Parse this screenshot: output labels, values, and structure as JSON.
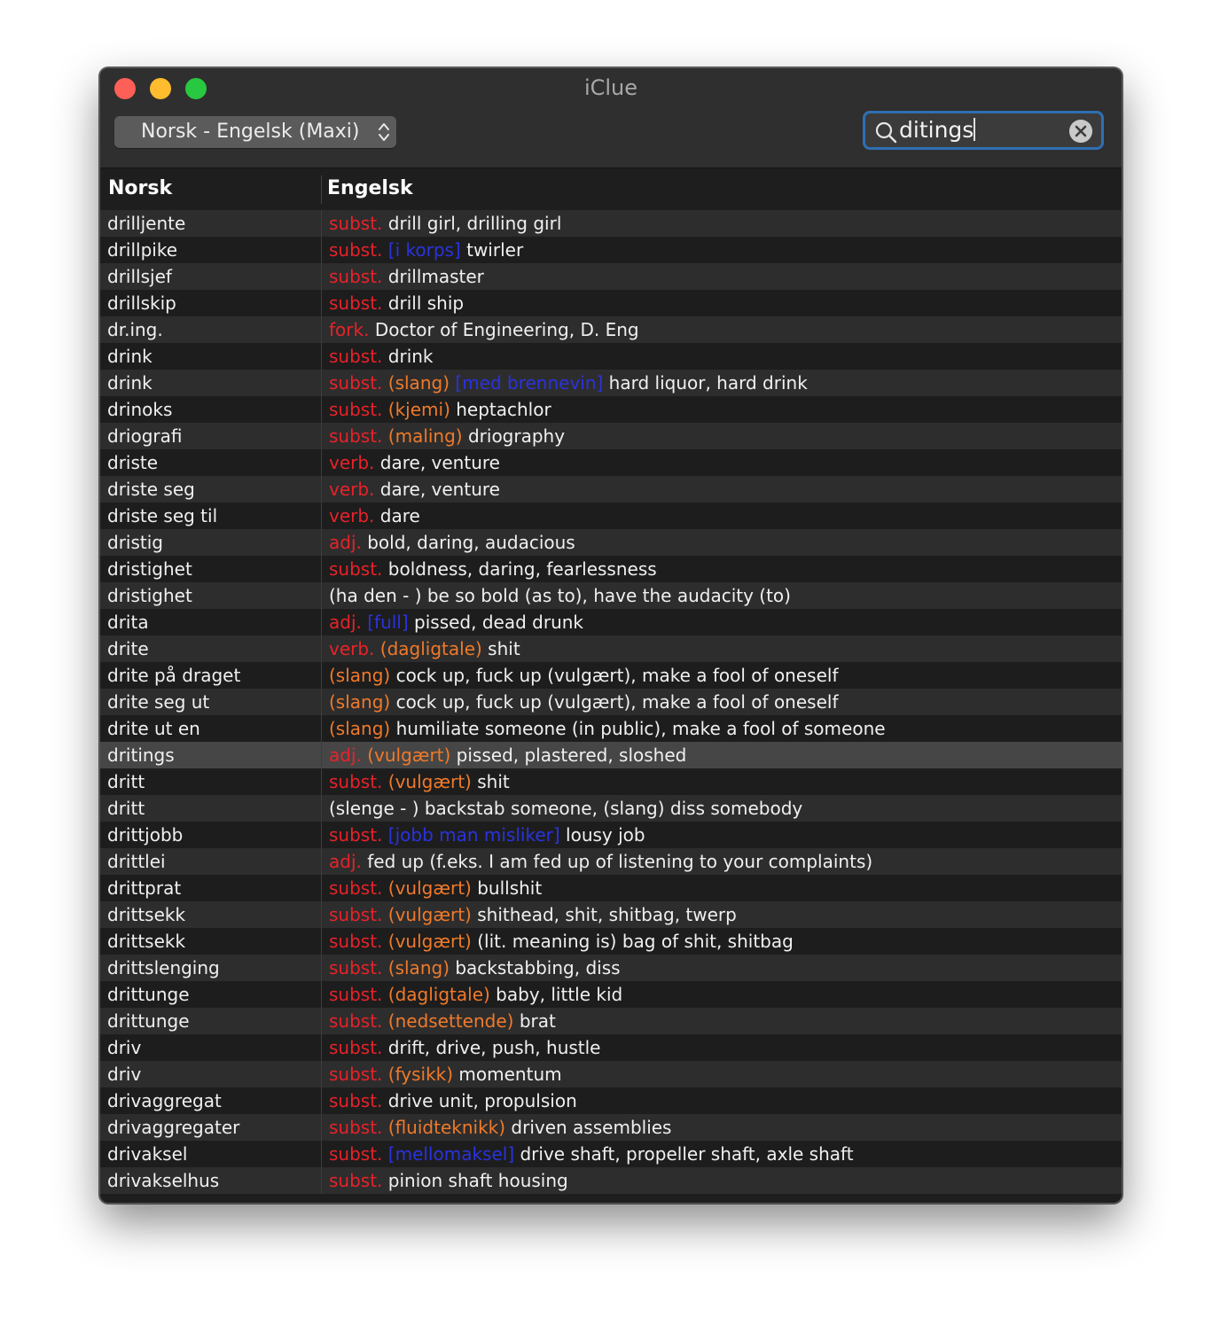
{
  "window": {
    "title": "iClue"
  },
  "dictionary_selector": {
    "value": "Norsk - Engelsk (Maxi)"
  },
  "search": {
    "value": "ditings"
  },
  "columns": {
    "left": "Norsk",
    "right": "Engelsk"
  },
  "selected_index": 20,
  "rows": [
    {
      "word": "drilljente",
      "pos": "subst.",
      "note": "",
      "ctx": "",
      "text": "drill girl, drilling girl"
    },
    {
      "word": "drillpike",
      "pos": "subst.",
      "note": "",
      "ctx": "[i korps]",
      "text": "twirler"
    },
    {
      "word": "drillsjef",
      "pos": "subst.",
      "note": "",
      "ctx": "",
      "text": "drillmaster"
    },
    {
      "word": "drillskip",
      "pos": "subst.",
      "note": "",
      "ctx": "",
      "text": "drill ship"
    },
    {
      "word": "dr.ing.",
      "pos": "fork.",
      "note": "",
      "ctx": "",
      "text": "Doctor of Engineering, D. Eng"
    },
    {
      "word": "drink",
      "pos": "subst.",
      "note": "",
      "ctx": "",
      "text": "drink"
    },
    {
      "word": "drink",
      "pos": "subst.",
      "note": "(slang)",
      "ctx": "[med brennevin]",
      "text": "hard liquor, hard drink"
    },
    {
      "word": "drinoks",
      "pos": "subst.",
      "note": "(kjemi)",
      "ctx": "",
      "text": "heptachlor"
    },
    {
      "word": "driografi",
      "pos": "subst.",
      "note": "(maling)",
      "ctx": "",
      "text": "driography"
    },
    {
      "word": "driste",
      "pos": "verb.",
      "note": "",
      "ctx": "",
      "text": "dare, venture"
    },
    {
      "word": "driste seg",
      "pos": "verb.",
      "note": "",
      "ctx": "",
      "text": "dare, venture"
    },
    {
      "word": "driste seg til",
      "pos": "verb.",
      "note": "",
      "ctx": "",
      "text": "dare"
    },
    {
      "word": "dristig",
      "pos": "adj.",
      "note": "",
      "ctx": "",
      "text": "bold, daring, audacious"
    },
    {
      "word": "dristighet",
      "pos": "subst.",
      "note": "",
      "ctx": "",
      "text": "boldness, daring, fearlessness"
    },
    {
      "word": "dristighet",
      "pos": "",
      "note": "",
      "ctx": "",
      "text": "(ha den - ) be so bold (as to), have the audacity (to)"
    },
    {
      "word": "drita",
      "pos": "adj.",
      "note": "",
      "ctx": "[full]",
      "text": "pissed, dead drunk"
    },
    {
      "word": "drite",
      "pos": "verb.",
      "note": "(dagligtale)",
      "ctx": "",
      "text": "shit"
    },
    {
      "word": "drite på draget",
      "pos": "",
      "note": "(slang)",
      "ctx": "",
      "text": "cock up, fuck up (vulgært), make a fool of oneself"
    },
    {
      "word": "drite seg ut",
      "pos": "",
      "note": "(slang)",
      "ctx": "",
      "text": "cock up, fuck up (vulgært), make a fool of oneself"
    },
    {
      "word": "drite ut en",
      "pos": "",
      "note": "(slang)",
      "ctx": "",
      "text": "humiliate someone (in public), make a fool of someone"
    },
    {
      "word": "dritings",
      "pos": "adj.",
      "note": "(vulgært)",
      "ctx": "",
      "text": "pissed, plastered, sloshed"
    },
    {
      "word": "dritt",
      "pos": "subst.",
      "note": "(vulgært)",
      "ctx": "",
      "text": "shit"
    },
    {
      "word": "dritt",
      "pos": "",
      "note": "",
      "ctx": "",
      "text": "(slenge - ) backstab someone, (slang) diss somebody"
    },
    {
      "word": "drittjobb",
      "pos": "subst.",
      "note": "",
      "ctx": "[jobb man misliker]",
      "text": "lousy job"
    },
    {
      "word": "drittlei",
      "pos": "adj.",
      "note": "",
      "ctx": "",
      "text": "fed up (f.eks. I am fed up of listening to your complaints)"
    },
    {
      "word": "drittprat",
      "pos": "subst.",
      "note": "(vulgært)",
      "ctx": "",
      "text": "bullshit"
    },
    {
      "word": "drittsekk",
      "pos": "subst.",
      "note": "(vulgært)",
      "ctx": "",
      "text": "shithead, shit, shitbag, twerp"
    },
    {
      "word": "drittsekk",
      "pos": "subst.",
      "note": "(vulgært)",
      "ctx": "",
      "text": "(lit. meaning is) bag of shit, shitbag"
    },
    {
      "word": "drittslenging",
      "pos": "subst.",
      "note": "(slang)",
      "ctx": "",
      "text": "backstabbing, diss"
    },
    {
      "word": "drittunge",
      "pos": "subst.",
      "note": "(dagligtale)",
      "ctx": "",
      "text": "baby, little kid"
    },
    {
      "word": "drittunge",
      "pos": "subst.",
      "note": "(nedsettende)",
      "ctx": "",
      "text": "brat"
    },
    {
      "word": "driv",
      "pos": "subst.",
      "note": "",
      "ctx": "",
      "text": "drift, drive, push, hustle"
    },
    {
      "word": "driv",
      "pos": "subst.",
      "note": "(fysikk)",
      "ctx": "",
      "text": "momentum"
    },
    {
      "word": "drivaggregat",
      "pos": "subst.",
      "note": "",
      "ctx": "",
      "text": "drive unit, propulsion"
    },
    {
      "word": "drivaggregater",
      "pos": "subst.",
      "note": "(fluidteknikk)",
      "ctx": "",
      "text": "driven assemblies"
    },
    {
      "word": "drivaksel",
      "pos": "subst.",
      "note": "",
      "ctx": "[mellomaksel]",
      "text": "drive shaft, propeller shaft, axle shaft"
    },
    {
      "word": "drivakselhus",
      "pos": "subst.",
      "note": "",
      "ctx": "",
      "text": "pinion shaft housing"
    }
  ]
}
